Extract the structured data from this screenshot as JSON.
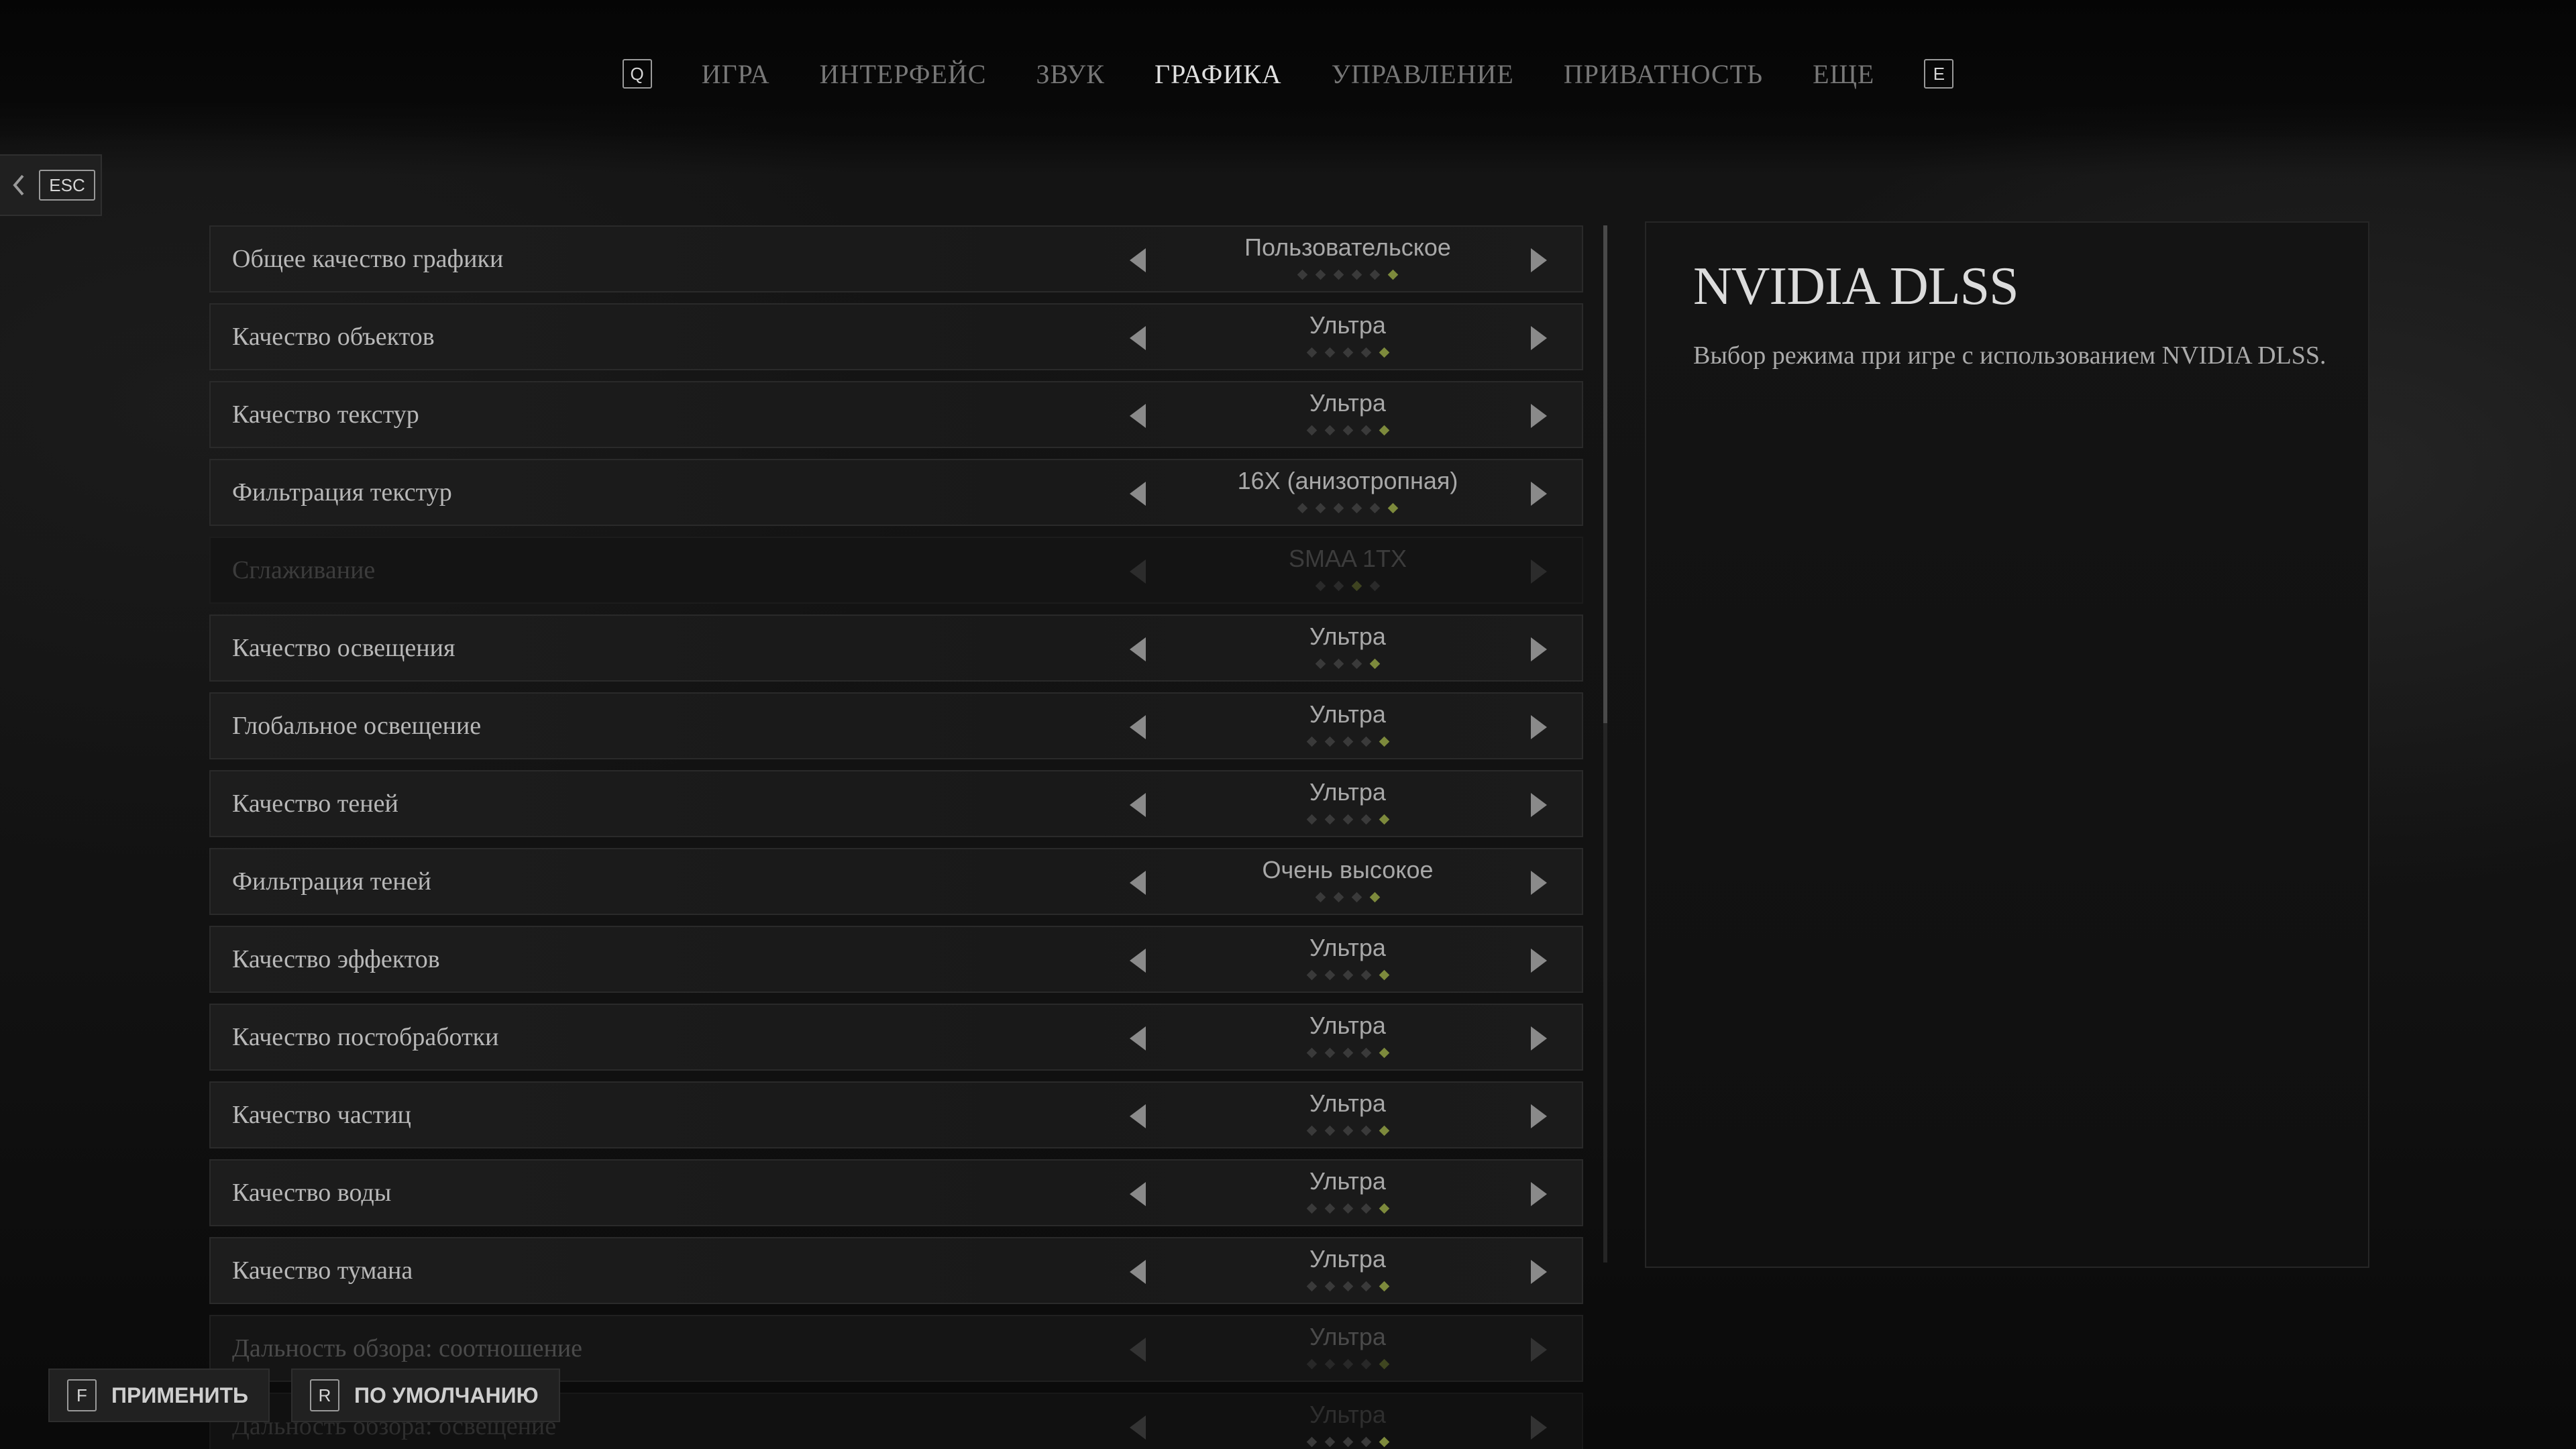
{
  "nav": {
    "prev_key": "Q",
    "next_key": "E",
    "tabs": [
      "ИГРА",
      "ИНТЕРФЕЙС",
      "ЗВУК",
      "ГРАФИКА",
      "УПРАВЛЕНИЕ",
      "ПРИВАТНОСТЬ",
      "ЕЩЕ"
    ],
    "active_tab": "ГРАФИКА"
  },
  "back": {
    "key": "ESC"
  },
  "settings": [
    {
      "label": "Общее качество графики",
      "value": "Пользовательское",
      "level": 6,
      "of": 6,
      "state": "normal"
    },
    {
      "label": "Качество объектов",
      "value": "Ультра",
      "level": 5,
      "of": 5,
      "state": "normal"
    },
    {
      "label": "Качество текстур",
      "value": "Ультра",
      "level": 5,
      "of": 5,
      "state": "normal"
    },
    {
      "label": "Фильтрация текстур",
      "value": "16X (анизотропная)",
      "level": 6,
      "of": 6,
      "state": "normal"
    },
    {
      "label": "Сглаживание",
      "value": "SMAA 1TX",
      "level": 3,
      "of": 4,
      "state": "disabled"
    },
    {
      "label": "Качество освещения",
      "value": "Ультра",
      "level": 4,
      "of": 4,
      "state": "normal"
    },
    {
      "label": "Глобальное освещение",
      "value": "Ультра",
      "level": 5,
      "of": 5,
      "state": "normal"
    },
    {
      "label": "Качество теней",
      "value": "Ультра",
      "level": 5,
      "of": 5,
      "state": "normal"
    },
    {
      "label": "Фильтрация теней",
      "value": "Очень высокое",
      "level": 4,
      "of": 4,
      "state": "normal"
    },
    {
      "label": "Качество эффектов",
      "value": "Ультра",
      "level": 5,
      "of": 5,
      "state": "normal"
    },
    {
      "label": "Качество постобработки",
      "value": "Ультра",
      "level": 5,
      "of": 5,
      "state": "normal"
    },
    {
      "label": "Качество частиц",
      "value": "Ультра",
      "level": 5,
      "of": 5,
      "state": "normal"
    },
    {
      "label": "Качество воды",
      "value": "Ультра",
      "level": 5,
      "of": 5,
      "state": "normal"
    },
    {
      "label": "Качество тумана",
      "value": "Ультра",
      "level": 5,
      "of": 5,
      "state": "normal"
    },
    {
      "label": "Дальность обзора: соотношение",
      "value": "Ультра",
      "level": 5,
      "of": 5,
      "state": "fade"
    },
    {
      "label": "Дальность обзора: освещение",
      "value": "Ультра",
      "level": 5,
      "of": 5,
      "state": "fade2"
    }
  ],
  "scroll": {
    "position": 0,
    "visible_fraction": 0.48
  },
  "info": {
    "title": "NVIDIA DLSS",
    "description": "Выбор режима при игре с использованием NVIDIA DLSS."
  },
  "actions": {
    "apply": {
      "key": "F",
      "label": "ПРИМЕНИТЬ"
    },
    "defaults": {
      "key": "R",
      "label": "ПО УМОЛЧАНИЮ"
    }
  },
  "colors": {
    "accent_dot": "#7d8a3c",
    "active_tab": "#e0e0e0",
    "inactive_tab": "#777777"
  }
}
